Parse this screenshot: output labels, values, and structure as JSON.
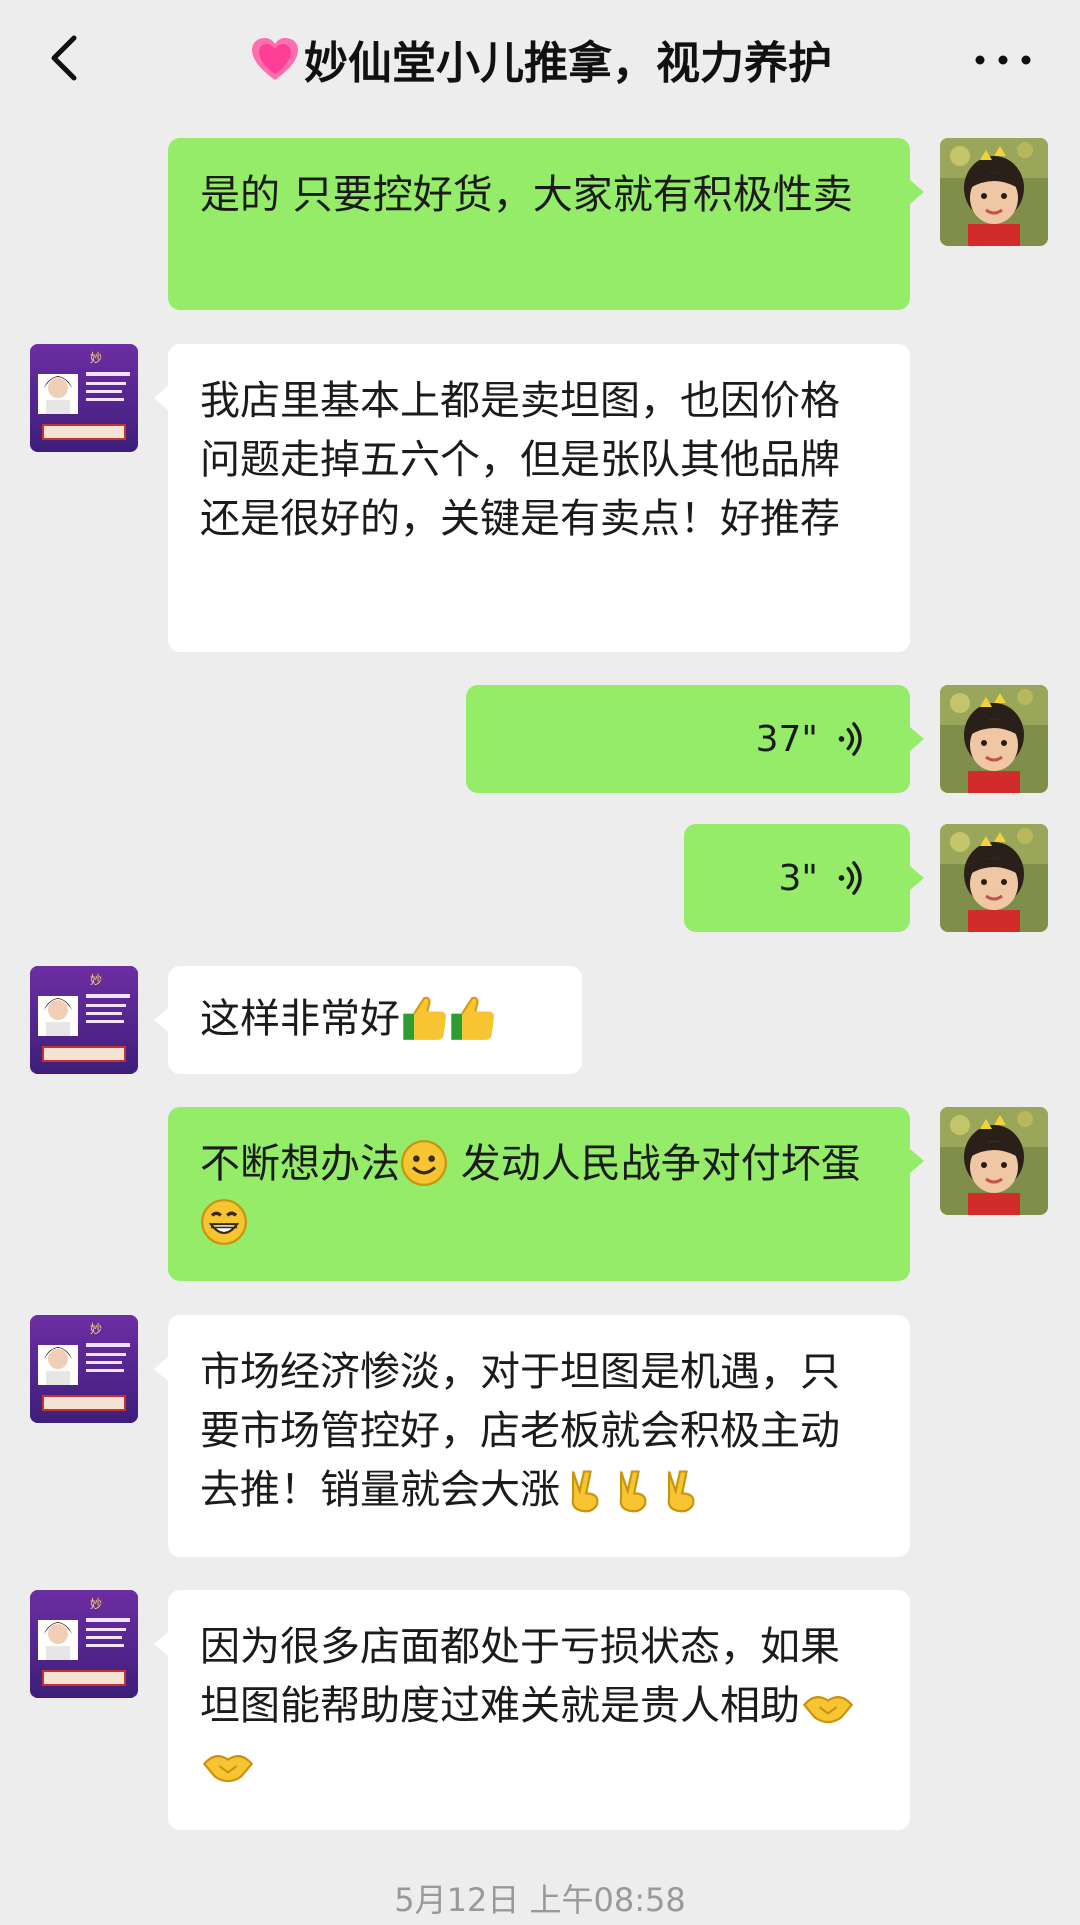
{
  "header": {
    "title": "妙仙堂小儿推拿，视力养护",
    "back_icon": "back-icon",
    "more_icon": "more-icon",
    "title_icon": "pink-heart-icon"
  },
  "colors": {
    "outgoing_bubble": "#95ec69",
    "incoming_bubble": "#ffffff",
    "chat_background": "#ededed"
  },
  "messages": [
    {
      "from": "me",
      "text": "是的 只要控好货，大家就有积极性卖"
    },
    {
      "from": "other",
      "text": "我店里基本上都是卖坦图，也因价格问题走掉五六个，但是张队其他品牌还是很好的，关键是有卖点！好推荐"
    },
    {
      "from": "me",
      "type": "voice",
      "duration": "37\""
    },
    {
      "from": "me",
      "type": "voice",
      "duration": "3\""
    },
    {
      "from": "other",
      "text": "这样非常好",
      "emojis": [
        "thumbs-up",
        "thumbs-up"
      ]
    },
    {
      "from": "me",
      "text_part1": "不断想办法",
      "text_part2": " 发动人民战争对付坏蛋",
      "emojis": [
        "smile",
        "grin"
      ]
    },
    {
      "from": "other",
      "text": "市场经济惨淡，对于坦图是机遇，只要市场管控好，店老板就会积极主动去推！销量就会大涨",
      "emojis": [
        "victory",
        "victory",
        "victory"
      ]
    },
    {
      "from": "other",
      "text": "因为很多店面都处于亏损状态，如果坦图能帮助度过难关就是贵人相助",
      "emojis": [
        "handshake",
        "handshake"
      ]
    }
  ],
  "timestamp": "5月12日 上午08:58"
}
